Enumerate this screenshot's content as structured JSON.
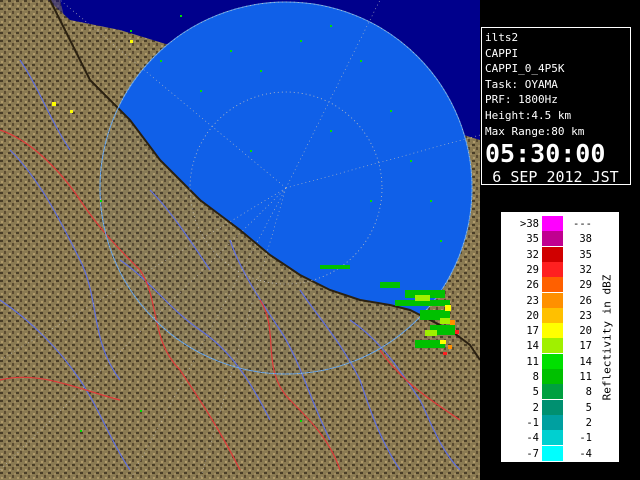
{
  "info": {
    "station": "ilts2",
    "product": "CAPPI",
    "product_id": "CAPPI_0_4P5K",
    "task": "Task: OYAMA",
    "prf": "PRF: 1800Hz",
    "height": "Height:4.5 km",
    "max_range": "Max Range:80 km",
    "time": "05:30:00",
    "date": "6 SEP 2012 JST"
  },
  "legend": {
    "title": "Reflectivity in dBZ",
    "rows": [
      {
        "low": ">38",
        "high": "---",
        "color": "#ff00ff"
      },
      {
        "low": "35",
        "high": "38",
        "color": "#c00090"
      },
      {
        "low": "32",
        "high": "35",
        "color": "#d00000"
      },
      {
        "low": "29",
        "high": "32",
        "color": "#ff2020"
      },
      {
        "low": "26",
        "high": "29",
        "color": "#ff6000"
      },
      {
        "low": "23",
        "high": "26",
        "color": "#ff9000"
      },
      {
        "low": "20",
        "high": "23",
        "color": "#ffc000"
      },
      {
        "low": "17",
        "high": "20",
        "color": "#ffff00"
      },
      {
        "low": "14",
        "high": "17",
        "color": "#a0f000"
      },
      {
        "low": "11",
        "high": "14",
        "color": "#00e000"
      },
      {
        "low": "8",
        "high": "11",
        "color": "#00c000"
      },
      {
        "low": "5",
        "high": "8",
        "color": "#00a040"
      },
      {
        "low": "2",
        "high": "5",
        "color": "#009070"
      },
      {
        "low": "-1",
        "high": "2",
        "color": "#00a0a0"
      },
      {
        "low": "-4",
        "high": "-1",
        "color": "#00d0d0"
      },
      {
        "low": "-7",
        "high": "-4",
        "color": "#00ffff"
      }
    ]
  },
  "colors": {
    "sea": "#1060e8",
    "range_circle": "#5aa0f0",
    "land": "#8a7a52",
    "land_dark": "#4a3e28",
    "rivers": "#6070e0",
    "borders": "#e03a3a"
  }
}
